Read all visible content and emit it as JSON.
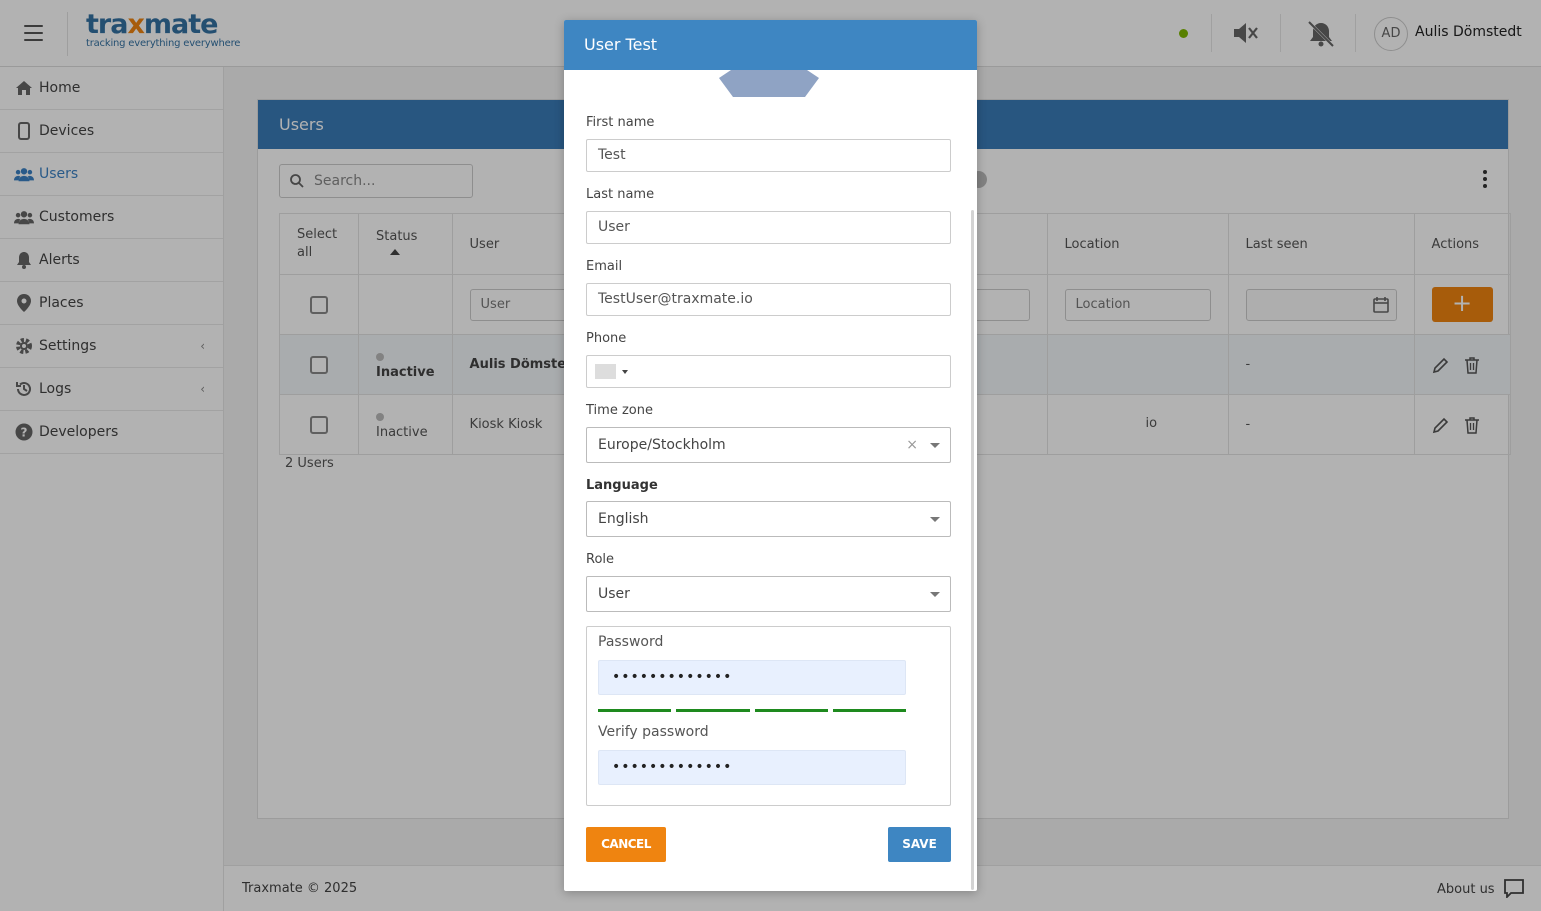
{
  "header": {
    "logo_main_a": "tra",
    "logo_main_x": "x",
    "logo_main_b": "mate",
    "logo_tagline": "tracking everything everywhere",
    "avatar_initials": "AD",
    "username": "Aulis Dömstedt",
    "status_color": "#7fb800"
  },
  "sidebar": {
    "items": [
      {
        "label": "Home",
        "icon": "home-icon"
      },
      {
        "label": "Devices",
        "icon": "device-icon"
      },
      {
        "label": "Users",
        "icon": "users-icon"
      },
      {
        "label": "Customers",
        "icon": "customers-icon"
      },
      {
        "label": "Alerts",
        "icon": "bell-icon"
      },
      {
        "label": "Places",
        "icon": "map-pin-icon"
      },
      {
        "label": "Settings",
        "icon": "gear-icon"
      },
      {
        "label": "Logs",
        "icon": "history-icon"
      },
      {
        "label": "Developers",
        "icon": "help-icon"
      }
    ],
    "active": "Users"
  },
  "main": {
    "title": "Users",
    "search_placeholder": "Search...",
    "columns": {
      "select_all": "Select all",
      "status": "Status",
      "user": "User",
      "location": "Location",
      "last_seen": "Last seen",
      "actions": "Actions"
    },
    "filters": {
      "user_placeholder": "User",
      "location_placeholder": "Location"
    },
    "rows": [
      {
        "status": "Inactive",
        "user": "Aulis Dömste",
        "last_seen": "-"
      },
      {
        "status": "Inactive",
        "user": "Kiosk Kiosk",
        "email_fragment": "io",
        "last_seen": "-"
      }
    ],
    "count": "2 Users"
  },
  "footer": {
    "copyright": "Traxmate © 2025",
    "about": "About us"
  },
  "modal": {
    "title": "User Test",
    "first_name_label": "First name",
    "first_name_value": "Test",
    "last_name_label": "Last name",
    "last_name_value": "User",
    "email_label": "Email",
    "email_value": "TestUser@traxmate.io",
    "phone_label": "Phone",
    "timezone_label": "Time zone",
    "timezone_value": "Europe/Stockholm",
    "timezone_clear": "×",
    "language_label": "Language",
    "language_value": "English",
    "role_label": "Role",
    "role_value": "User",
    "password_label": "Password",
    "password_value": "•••••••••••••",
    "verify_label": "Verify password",
    "verify_value": "•••••••••••••",
    "cancel_label": "CANCEL",
    "save_label": "SAVE",
    "accent_orange": "#ef8410",
    "accent_blue": "#3e86c2"
  }
}
